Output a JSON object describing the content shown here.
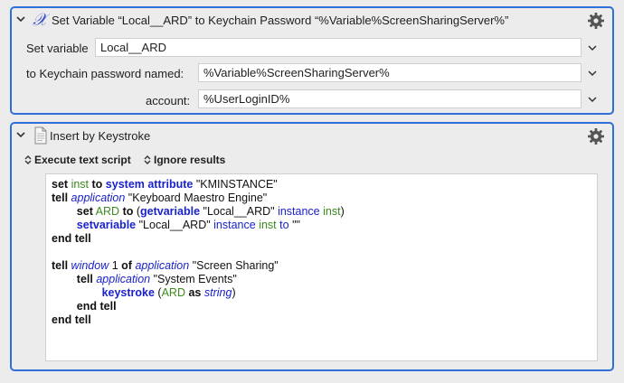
{
  "action1": {
    "title": "Set Variable “Local__ARD” to Keychain Password “%Variable%ScreenSharingServer%”",
    "set_variable_label": "Set variable",
    "set_variable_value": "Local__ARD",
    "keychain_label": "to Keychain password named:",
    "keychain_value": "%Variable%ScreenSharingServer%",
    "account_label": "account:",
    "account_value": "%UserLoginID%"
  },
  "action2": {
    "title": "Insert by Keystroke",
    "option_execute": "Execute text script",
    "option_ignore": "Ignore results",
    "script_lines": [
      [
        [
          "kw",
          "set"
        ],
        [
          "t",
          " "
        ],
        [
          "var",
          "inst"
        ],
        [
          "t",
          " "
        ],
        [
          "kw",
          "to"
        ],
        [
          "t",
          " "
        ],
        [
          "bl",
          "system attribute"
        ],
        [
          "t",
          " "
        ],
        [
          "str",
          "\"KMINSTANCE\""
        ]
      ],
      [
        [
          "kw",
          "tell"
        ],
        [
          "t",
          " "
        ],
        [
          "cls",
          "application"
        ],
        [
          "t",
          " "
        ],
        [
          "str",
          "\"Keyboard Maestro Engine\""
        ]
      ],
      [
        [
          "t",
          "        "
        ],
        [
          "kw",
          "set"
        ],
        [
          "t",
          " "
        ],
        [
          "var",
          "ARD"
        ],
        [
          "t",
          " "
        ],
        [
          "kw",
          "to"
        ],
        [
          "t",
          " ("
        ],
        [
          "bl",
          "getvariable"
        ],
        [
          "t",
          " "
        ],
        [
          "str",
          "\"Local__ARD\""
        ],
        [
          "t",
          " "
        ],
        [
          "prop",
          "instance"
        ],
        [
          "t",
          " "
        ],
        [
          "var",
          "inst"
        ],
        [
          "t",
          ")"
        ]
      ],
      [
        [
          "t",
          "        "
        ],
        [
          "bl",
          "setvariable"
        ],
        [
          "t",
          " "
        ],
        [
          "str",
          "\"Local__ARD\""
        ],
        [
          "t",
          " "
        ],
        [
          "prop",
          "instance"
        ],
        [
          "t",
          " "
        ],
        [
          "var",
          "inst"
        ],
        [
          "t",
          " "
        ],
        [
          "prop",
          "to"
        ],
        [
          "t",
          " "
        ],
        [
          "str",
          "\"\""
        ]
      ],
      [
        [
          "kw",
          "end tell"
        ]
      ],
      [
        [
          "t",
          ""
        ]
      ],
      [
        [
          "kw",
          "tell"
        ],
        [
          "t",
          " "
        ],
        [
          "cls",
          "window"
        ],
        [
          "t",
          " 1 "
        ],
        [
          "kw",
          "of"
        ],
        [
          "t",
          " "
        ],
        [
          "cls",
          "application"
        ],
        [
          "t",
          " "
        ],
        [
          "str",
          "\"Screen Sharing\""
        ]
      ],
      [
        [
          "t",
          "        "
        ],
        [
          "kw",
          "tell"
        ],
        [
          "t",
          " "
        ],
        [
          "cls",
          "application"
        ],
        [
          "t",
          " "
        ],
        [
          "str",
          "\"System Events\""
        ]
      ],
      [
        [
          "t",
          "                "
        ],
        [
          "bl",
          "keystroke"
        ],
        [
          "t",
          " ("
        ],
        [
          "var",
          "ARD"
        ],
        [
          "t",
          " "
        ],
        [
          "kw",
          "as"
        ],
        [
          "t",
          " "
        ],
        [
          "cls",
          "string"
        ],
        [
          "t",
          ")"
        ]
      ],
      [
        [
          "t",
          "        "
        ],
        [
          "kw",
          "end tell"
        ]
      ],
      [
        [
          "kw",
          "end tell"
        ]
      ]
    ]
  },
  "icons": {
    "action1": "variable-x-icon",
    "action2": "document-icon",
    "gear": "gear-icon",
    "collapse": "chevron-down-icon"
  },
  "colors": {
    "accent_border": "#2f6fd8",
    "keyword": "#111111",
    "class": "#1a22cc",
    "variable": "#3c8a1e"
  }
}
